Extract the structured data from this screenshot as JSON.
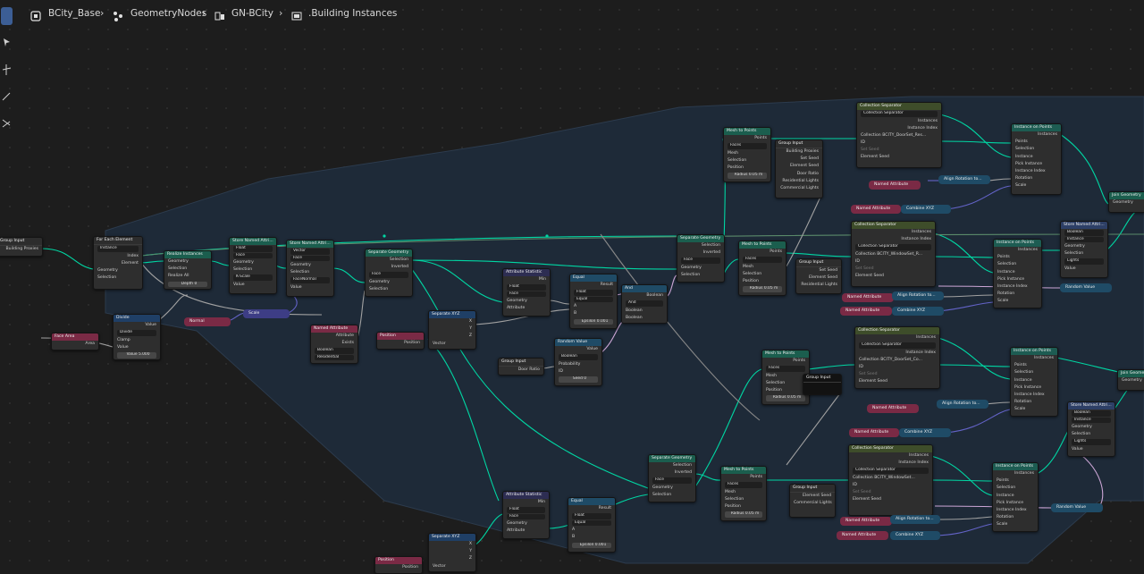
{
  "breadcrumbs": [
    {
      "label": "BCity_Base",
      "icon": "scene-icon"
    },
    {
      "label": "GeometryNodes",
      "icon": "nodes-icon"
    },
    {
      "label": "GN-BCity",
      "icon": "node-tree-icon"
    },
    {
      "label": ".Building Instances",
      "icon": "node-group-icon"
    }
  ],
  "nodes": {
    "group_input_main": {
      "title": "Group Input",
      "out1": "Building Proxies"
    },
    "for_each": {
      "title": "For Each Element",
      "domain": "Instance",
      "out_index": "Index",
      "out_element": "Element",
      "in_geometry": "Geometry",
      "in_selection": "Selection"
    },
    "realize": {
      "title": "Realize Instances",
      "geometry": "Geometry",
      "selection": "Selection",
      "realize_all": "Realize All",
      "depth": "Depth",
      "depth_val": "0"
    },
    "store1": {
      "title": "Store Named Attri...",
      "type": "Float",
      "domain": "Face",
      "geometry": "Geometry",
      "selection": "Selection",
      "name": "K-Scale",
      "value": "Value"
    },
    "store2": {
      "title": "Store Named Attri...",
      "type": "Vector",
      "domain": "Face",
      "geometry": "Geometry",
      "selection": "Selection",
      "name": "FaceNormal",
      "value": "Value"
    },
    "face_area": {
      "title": "Face Area",
      "out": "Area"
    },
    "divide": {
      "title": "Divide",
      "out": "Value",
      "op": "Divide",
      "clamp": "Clamp",
      "value": "Value",
      "value2": "Value",
      "value2_num": "5.000"
    },
    "normal": {
      "title": "Normal"
    },
    "scale": {
      "title": "Scale"
    },
    "named_attr_a": {
      "title": "Named Attribute",
      "attr": "Attribute",
      "exists": "Exists",
      "type": "Boolean",
      "name": "Residential"
    },
    "position_a": {
      "title": "Position",
      "out": "Position"
    },
    "sep_geo_1": {
      "title": "Separate Geometry",
      "selection": "Selection",
      "inverted": "Inverted",
      "domain": "Face",
      "geometry": "Geometry",
      "sel_in": "Selection"
    },
    "sep_xyz_1": {
      "title": "Separate XYZ",
      "x": "X",
      "y": "Y",
      "z": "Z",
      "vec": "Vector"
    },
    "attr_stat_1": {
      "title": "Attribute Statistic",
      "min": "Min",
      "type": "Float",
      "domain": "Face",
      "geometry": "Geometry",
      "selection": "Selection",
      "attribute": "Attribute"
    },
    "equal_1": {
      "title": "Equal",
      "result": "Result",
      "type": "Float",
      "op": "Equal",
      "a": "A",
      "b": "B",
      "epsilon": "Epsilon",
      "eps_val": "0.001"
    },
    "and_1": {
      "title": "And",
      "boolean": "Boolean",
      "op": "And",
      "in1": "Boolean",
      "in2": "Boolean"
    },
    "random_value": {
      "title": "Random Value",
      "value": "Value",
      "type": "Boolean",
      "probability": "Probability",
      "id": "ID",
      "seed": "Seed",
      "seed_val": "0"
    },
    "group_input_door": {
      "title": "Group Input",
      "out": "Door Ratio"
    },
    "sep_geo_2": {
      "title": "Separate Geometry",
      "selection": "Selection",
      "inverted": "Inverted",
      "domain": "Face",
      "geometry": "Geometry",
      "sel_in": "Selection"
    },
    "mesh_to_points_1": {
      "title": "Mesh to Points",
      "points": "Points",
      "mode": "Faces",
      "mesh": "Mesh",
      "selection": "Selection",
      "position": "Position",
      "radius": "Radius",
      "radius_val": "0.05 m"
    },
    "group_input_big": {
      "title": "Group Input",
      "o1": "Building Proxies",
      "o2": "Set Seed",
      "o3": "Element Seed",
      "o4": "Door Ratio",
      "o5": "Residential Lights",
      "o6": "Commercial Lights"
    },
    "col_sep_1": {
      "title": "Collection Separator",
      "grp": "Collection Separator",
      "instances": "Instances",
      "inst_index": "Instance Index",
      "collection": "Collection",
      "col_val": "BCITY_DoorSet_Res...",
      "id": "ID",
      "set_seed": "Set Seed",
      "elem_seed": "Element Seed"
    },
    "inst_on_points_1": {
      "title": "Instance on Points",
      "instances": "Instances",
      "points": "Points",
      "selection": "Selection",
      "instance": "Instance",
      "pick": "Pick Instance",
      "inst_index": "Instance Index",
      "rotation": "Rotation",
      "scale": "Scale"
    },
    "named_attr_b": {
      "title": "Named Attribute"
    },
    "align_b": {
      "title": "Align Rotation to..."
    },
    "named_attr_c": {
      "title": "Named Attribute"
    },
    "combine_c": {
      "title": "Combine XYZ"
    },
    "join_geo_1": {
      "title": "Join Geometry",
      "geometry": "Geometry"
    },
    "mesh_to_points_2": {
      "title": "Mesh to Points",
      "points": "Points",
      "mode": "Faces",
      "mesh": "Mesh",
      "selection": "Selection",
      "position": "Position",
      "radius": "Radius",
      "radius_val": "0.05 m"
    },
    "group_input_2": {
      "title": "Group Input",
      "o1": "ID",
      "o2": "Set Seed",
      "o3": "Element Seed",
      "o4": "Residential Lights"
    },
    "col_sep_2": {
      "title": "Collection Separator",
      "grp": "Collection Separator",
      "instances": "Instances",
      "inst_index": "Instance Index",
      "collection": "Collection",
      "col_val": "BCITY_WindowSet_R...",
      "id": "ID",
      "set_seed": "Set Seed",
      "elem_seed": "Element Seed"
    },
    "inst_on_points_2": {
      "title": "Instance on Points",
      "instances": "Instances",
      "points": "Points",
      "selection": "Selection",
      "instance": "Instance",
      "pick": "Pick Instance",
      "inst_index": "Instance Index",
      "rotation": "Rotation",
      "scale": "Scale"
    },
    "store3": {
      "title": "Store Named Attri...",
      "type": "Boolean",
      "domain": "Instance",
      "geometry": "Geometry",
      "selection": "Selection",
      "name": "Lights",
      "value": "Value"
    },
    "random_value_2": {
      "title": "Random Value"
    },
    "named_attr_d": {
      "title": "Named Attribute"
    },
    "align_d": {
      "title": "Align Rotation to..."
    },
    "named_attr_e": {
      "title": "Named Attribute"
    },
    "combine_e": {
      "title": "Combine XYZ"
    },
    "mesh_to_points_3": {
      "title": "Mesh to Points",
      "points": "Points",
      "mode": "Faces",
      "mesh": "Mesh",
      "selection": "Selection",
      "position": "Position",
      "radius": "Radius",
      "radius_val": "0.05 m"
    },
    "group_input_3": {
      "title": "Group Input"
    },
    "col_sep_3": {
      "title": "Collection Separator",
      "grp": "Collection Separator",
      "instances": "Instances",
      "inst_index": "Instance Index",
      "collection": "Collection",
      "col_val": "BCITY_DoorSet_Co...",
      "id": "ID",
      "set_seed": "Set Seed",
      "elem_seed": "Element Seed"
    },
    "inst_on_points_3": {
      "title": "Instance on Points",
      "instances": "Instances",
      "points": "Points",
      "selection": "Selection",
      "instance": "Instance",
      "pick": "Pick Instance",
      "inst_index": "Instance Index",
      "rotation": "Rotation",
      "scale": "Scale"
    },
    "join_geo_2": {
      "title": "Join Geometry",
      "geometry": "Geometry"
    },
    "store4": {
      "title": "Store Named Attri...",
      "type": "Boolean",
      "domain": "Instance",
      "geometry": "Geometry",
      "selection": "Selection",
      "name": "Lights",
      "value": "Value"
    },
    "named_attr_f": {
      "title": "Named Attribute"
    },
    "align_f": {
      "title": "Align Rotation to..."
    },
    "named_attr_g": {
      "title": "Named Attribute"
    },
    "combine_g": {
      "title": "Combine XYZ"
    },
    "sep_geo_3": {
      "title": "Separate Geometry",
      "selection": "Selection",
      "inverted": "Inverted",
      "domain": "Face",
      "geometry": "Geometry",
      "sel_in": "Selection"
    },
    "mesh_to_points_4": {
      "title": "Mesh to Points",
      "points": "Points",
      "mode": "Faces",
      "mesh": "Mesh",
      "selection": "Selection",
      "position": "Position",
      "radius": "Radius",
      "radius_val": "0.05 m"
    },
    "group_input_4": {
      "title": "Group Input",
      "o1": "ID",
      "o2": "Set Seed",
      "o3": "Element Seed",
      "o4": "Commercial Lights"
    },
    "col_sep_4": {
      "title": "Collection Separator",
      "grp": "Collection Separator",
      "instances": "Instances",
      "inst_index": "Instance Index",
      "collection": "Collection",
      "col_val": "BCITY_WindowSet...",
      "id": "ID",
      "set_seed": "Set Seed",
      "elem_seed": "Element Seed"
    },
    "inst_on_points_4": {
      "title": "Instance on Points",
      "instances": "Instances",
      "points": "Points",
      "selection": "Selection",
      "instance": "Instance",
      "pick": "Pick Instance",
      "inst_index": "Instance Index",
      "rotation": "Rotation",
      "scale": "Scale"
    },
    "random_value_3": {
      "title": "Random Value"
    },
    "named_attr_h": {
      "title": "Named Attribute"
    },
    "align_h": {
      "title": "Align Rotation to..."
    },
    "named_attr_i": {
      "title": "Named Attribute"
    },
    "combine_i": {
      "title": "Combine XYZ"
    },
    "attr_stat_2": {
      "title": "Attribute Statistic",
      "min": "Min",
      "type": "Float",
      "domain": "Face",
      "geometry": "Geometry",
      "selection": "Selection",
      "attribute": "Attribute"
    },
    "equal_2": {
      "title": "Equal",
      "result": "Result",
      "type": "Float",
      "op": "Equal",
      "a": "A",
      "b": "B",
      "epsilon": "Epsilon",
      "eps_val": "0.001"
    },
    "sep_xyz_2": {
      "title": "Separate XYZ",
      "x": "X",
      "y": "Y",
      "z": "Z",
      "vec": "Vector"
    },
    "position_b": {
      "title": "Position",
      "out": "Position"
    }
  },
  "colors": {
    "geometry_socket": "#00d6a3",
    "frame": "#223041",
    "background": "#1d1d1d"
  }
}
